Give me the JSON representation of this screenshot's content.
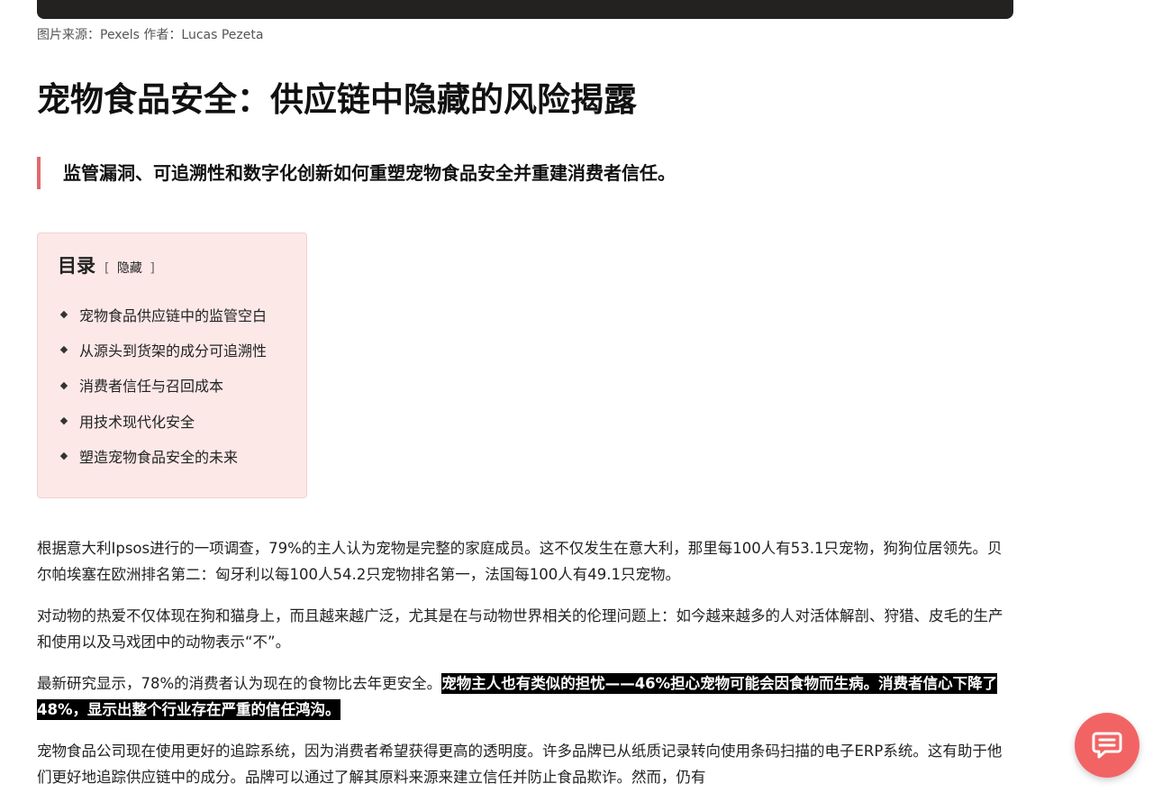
{
  "image_caption": "图片来源：Pexels 作者：Lucas Pezeta",
  "article": {
    "title": "宠物食品安全：供应链中隐藏的风险揭露",
    "subtitle": "监管漏洞、可追溯性和数字化创新如何重塑宠物食品安全并重建消费者信任。"
  },
  "toc": {
    "title": "目录",
    "bracket_open": "[",
    "toggle_label": "隐藏",
    "bracket_close": "]",
    "items": [
      {
        "label": "宠物食品供应链中的监管空白"
      },
      {
        "label": "从源头到货架的成分可追溯性"
      },
      {
        "label": "消费者信任与召回成本"
      },
      {
        "label": "用技术现代化安全"
      },
      {
        "label": "塑造宠物食品安全的未来"
      }
    ]
  },
  "paragraphs": {
    "p1": "根据意大利Ipsos进行的一项调查，79%的主人认为宠物是完整的家庭成员。这不仅发生在意大利，那里每100人有53.1只宠物，狗狗位居领先。贝尔帕埃塞在欧洲排名第二：匈牙利以每100人54.2只宠物排名第一，法国每100人有49.1只宠物。",
    "p2": "对动物的热爱不仅体现在狗和猫身上，而且越来越广泛，尤其是在与动物世界相关的伦理问题上：如今越来越多的人对活体解剖、狩猎、皮毛的生产和使用以及马戏团中的动物表示“不”。",
    "p3_plain": "最新研究显示，78%的消费者认为现在的食物比去年更安全。",
    "p3_highlight": "宠物主人也有类似的担忧——46%担心宠物可能会因食物而生病。消费者信心下降了48%，显示出整个行业存在严重的信任鸿沟。",
    "p4": "宠物食品公司现在使用更好的追踪系统，因为消费者希望获得更高的透明度。许多品牌已从纸质记录转向使用条码扫描的电子ERP系统。这有助于他们更好地追踪供应链中的成分。品牌可以通过了解其原料来源来建立信任并防止食品欺诈。然而，仍有"
  },
  "chat_button": {
    "icon": "chat-bubble-icon"
  },
  "colors": {
    "accent_red": "#e06a6a",
    "toc_background": "#fde8e8",
    "chat_button": "#f26464",
    "highlight_bg": "#000000"
  }
}
